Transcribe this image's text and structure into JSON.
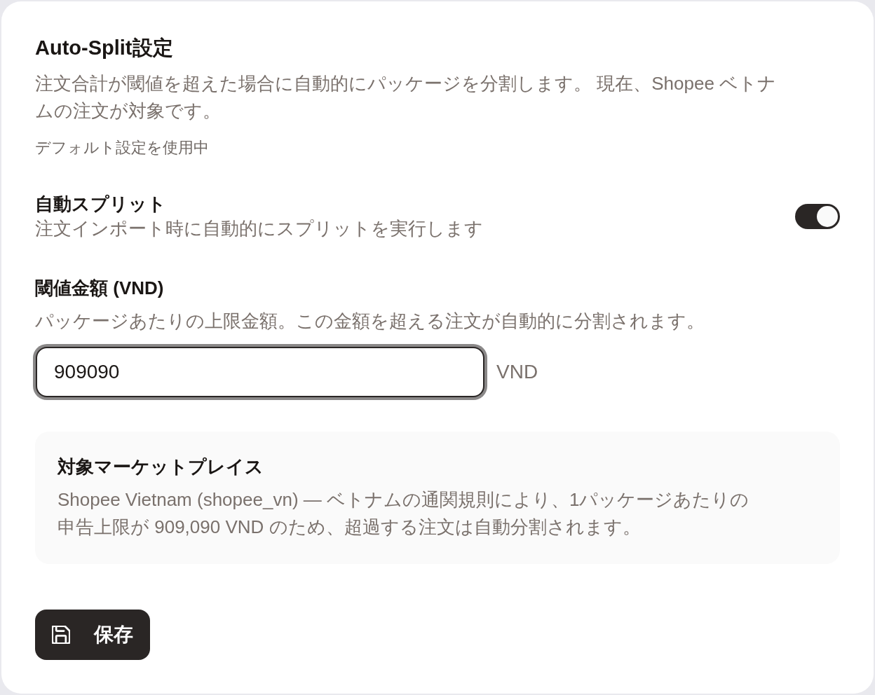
{
  "header": {
    "title": "Auto-Split設定",
    "description": "注文合計が閾値を超えた場合に自動的にパッケージを分割します。 現在、Shopee ベトナムの注文が対象です。",
    "status": "デフォルト設定を使用中"
  },
  "auto_split": {
    "label": "自動スプリット",
    "description": "注文インポート時に自動的にスプリットを実行します",
    "on": true
  },
  "threshold": {
    "label": "閾値金額 (VND)",
    "help": "パッケージあたりの上限金額。この金額を超える注文が自動的に分割されます。",
    "value": "909090",
    "unit": "VND",
    "focused": true
  },
  "marketplace": {
    "title": "対象マーケットプレイス",
    "text": "Shopee Vietnam (shopee_vn) — ベトナムの通関規則により、1パッケージあたりの申告上限が 909,090 VND のため、超過する注文は自動分割されます。"
  },
  "save_button": {
    "label": "保存"
  }
}
